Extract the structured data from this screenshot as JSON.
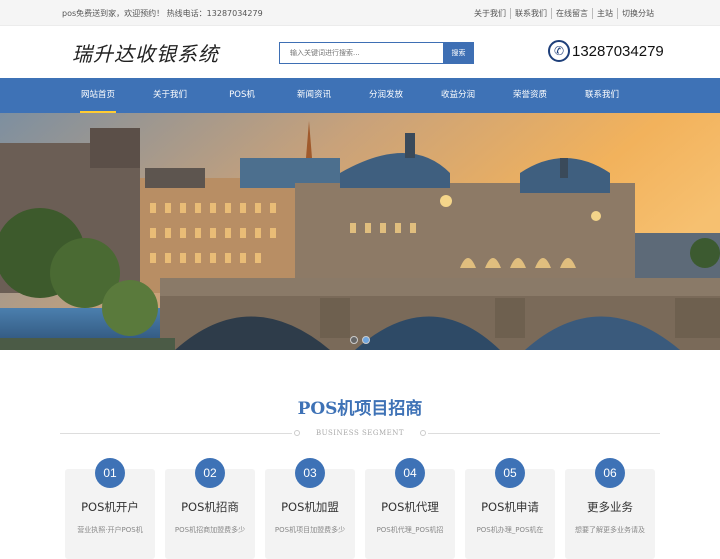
{
  "topbar": {
    "welcome": "pos免费送到家，欢迎预约！ 热线电话：13287034279",
    "links": [
      "关于我们",
      "联系我们",
      "在线留言",
      "主站",
      "切换分站"
    ]
  },
  "header": {
    "logo": "瑞升达收银系统",
    "search_placeholder": "输入关键词进行搜索...",
    "search_button": "搜索",
    "phone_icon": "phone-icon",
    "phone": "13287034279"
  },
  "nav": {
    "items": [
      "网站首页",
      "关于我们",
      "POS机",
      "新闻资讯",
      "分润发放",
      "收益分润",
      "荣誉资质",
      "联系我们"
    ],
    "active_index": 0
  },
  "banner": {
    "slide_count": 2,
    "active_slide": 1
  },
  "section": {
    "title": "POS机项目招商",
    "subtitle": "BUSINESS SEGMENT",
    "cards": [
      {
        "num": "01",
        "title": "POS机开户",
        "desc": "营业执照·开户POS机"
      },
      {
        "num": "02",
        "title": "POS机招商",
        "desc": "POS机招商加盟费多少"
      },
      {
        "num": "03",
        "title": "POS机加盟",
        "desc": "POS机项目加盟费多少"
      },
      {
        "num": "04",
        "title": "POS机代理",
        "desc": "POS机代理_POS机招"
      },
      {
        "num": "05",
        "title": "POS机申请",
        "desc": "POS机办理_POS机在"
      },
      {
        "num": "06",
        "title": "更多业务",
        "desc": "想要了解更多业务请及"
      }
    ]
  },
  "colors": {
    "brand": "#3e72b6",
    "nav_underline": "#ffcc33"
  }
}
